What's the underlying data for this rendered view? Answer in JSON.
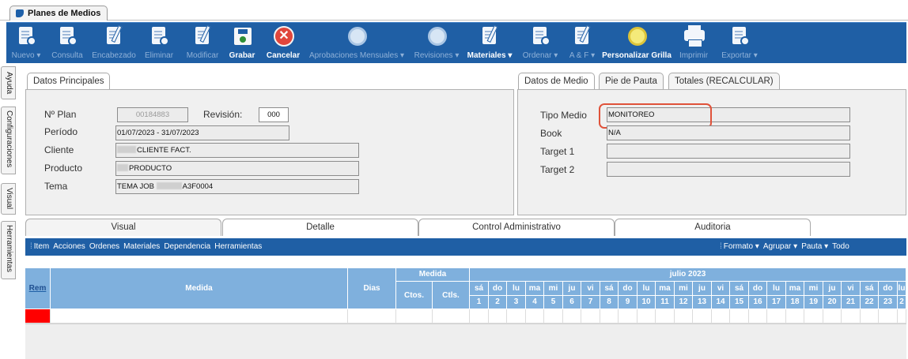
{
  "window": {
    "tab_title": "Planes de Medios"
  },
  "toolbar": {
    "items": [
      {
        "label": "Nuevo ▾",
        "icon": "new-document-icon",
        "enabled": false
      },
      {
        "label": "Consulta",
        "icon": "query-document-icon",
        "enabled": false
      },
      {
        "label": "Encabezado",
        "icon": "header-edit-icon",
        "enabled": false
      },
      {
        "label": "Eliminar",
        "icon": "delete-document-icon",
        "enabled": false
      },
      {
        "label": "Modificar",
        "icon": "edit-pencil-icon",
        "enabled": false
      },
      {
        "label": "Grabar",
        "icon": "save-icon",
        "enabled": true
      },
      {
        "label": "Cancelar",
        "icon": "cancel-icon",
        "enabled": true
      },
      {
        "label": "Aprobaciones Mensuales ▾",
        "icon": "thumbs-up-icon",
        "enabled": false
      },
      {
        "label": "Revisiones ▾",
        "icon": "thumbs-up-icon",
        "enabled": false
      },
      {
        "label": "Materiales ▾",
        "icon": "materials-pencil-icon",
        "enabled": true
      },
      {
        "label": "Ordenar ▾",
        "icon": "sort-document-icon",
        "enabled": false
      },
      {
        "label": "A & F ▾",
        "icon": "af-pencil-icon",
        "enabled": false
      },
      {
        "label": "Personalizar Grilla",
        "icon": "grid-globe-icon",
        "enabled": true
      },
      {
        "label": "Imprimir",
        "icon": "printer-icon",
        "enabled": false
      },
      {
        "label": "Exportar ▾",
        "icon": "export-document-icon",
        "enabled": false
      }
    ]
  },
  "side_tabs": [
    "Ayuda",
    "Configuraciones",
    "Visual",
    "Herramientas"
  ],
  "datos_principales": {
    "tab_label": "Datos Principales",
    "plan_label": "Nº Plan",
    "plan_value": "00184883",
    "revision_label": "Revisión:",
    "revision_value": "000",
    "periodo_label": "Período",
    "periodo_value": "01/07/2023 - 31/07/2023",
    "cliente_label": "Cliente",
    "cliente_value": "CLIENTE FACT.",
    "producto_label": "Producto",
    "producto_value": "PRODUCTO",
    "tema_label": "Tema",
    "tema_value_prefix": "TEMA JOB",
    "tema_value_suffix": "A3F0004"
  },
  "datos_medio": {
    "tabs": [
      "Datos de Medio",
      "Pie de Pauta",
      "Totales (RECALCULAR)"
    ],
    "tipo_medio_label": "Tipo Medio",
    "tipo_medio_value": "MONITOREO",
    "book_label": "Book",
    "book_value": "N/A",
    "target1_label": "Target 1",
    "target1_value": "",
    "target2_label": "Target 2",
    "target2_value": ""
  },
  "bottom_tabs": [
    "Visual",
    "Detalle",
    "Control Administrativo",
    "Auditoria"
  ],
  "grid_menu": {
    "left": [
      "Item",
      "Acciones",
      "Ordenes",
      "Materiales",
      "Dependencia",
      "Herramientas"
    ],
    "right": [
      "Formato ▾",
      "Agrupar ▾",
      "Pauta ▾",
      "Todo"
    ]
  },
  "grid": {
    "col_rem": "Rem",
    "col_medida": "Medida",
    "col_dias": "Dias",
    "group_medida": "Medida",
    "col_ctos": "Ctos.",
    "col_ctls": "Ctls.",
    "month_label": "julio 2023",
    "day_names": [
      "sá",
      "do",
      "lu",
      "ma",
      "mi",
      "ju",
      "vi",
      "sá",
      "do",
      "lu",
      "ma",
      "mi",
      "ju",
      "vi",
      "sá",
      "do",
      "lu",
      "ma",
      "mi",
      "ju",
      "vi",
      "sá",
      "do",
      "lu"
    ],
    "day_numbers": [
      "1",
      "2",
      "3",
      "4",
      "5",
      "6",
      "7",
      "8",
      "9",
      "10",
      "11",
      "12",
      "13",
      "14",
      "15",
      "16",
      "17",
      "18",
      "19",
      "20",
      "21",
      "22",
      "23",
      "2"
    ]
  },
  "colors": {
    "toolbar_blue": "#1f5fa5",
    "grid_header_blue": "#7fb0dd",
    "highlight_red": "#e0523a",
    "row_marker_red": "#ff0000"
  }
}
